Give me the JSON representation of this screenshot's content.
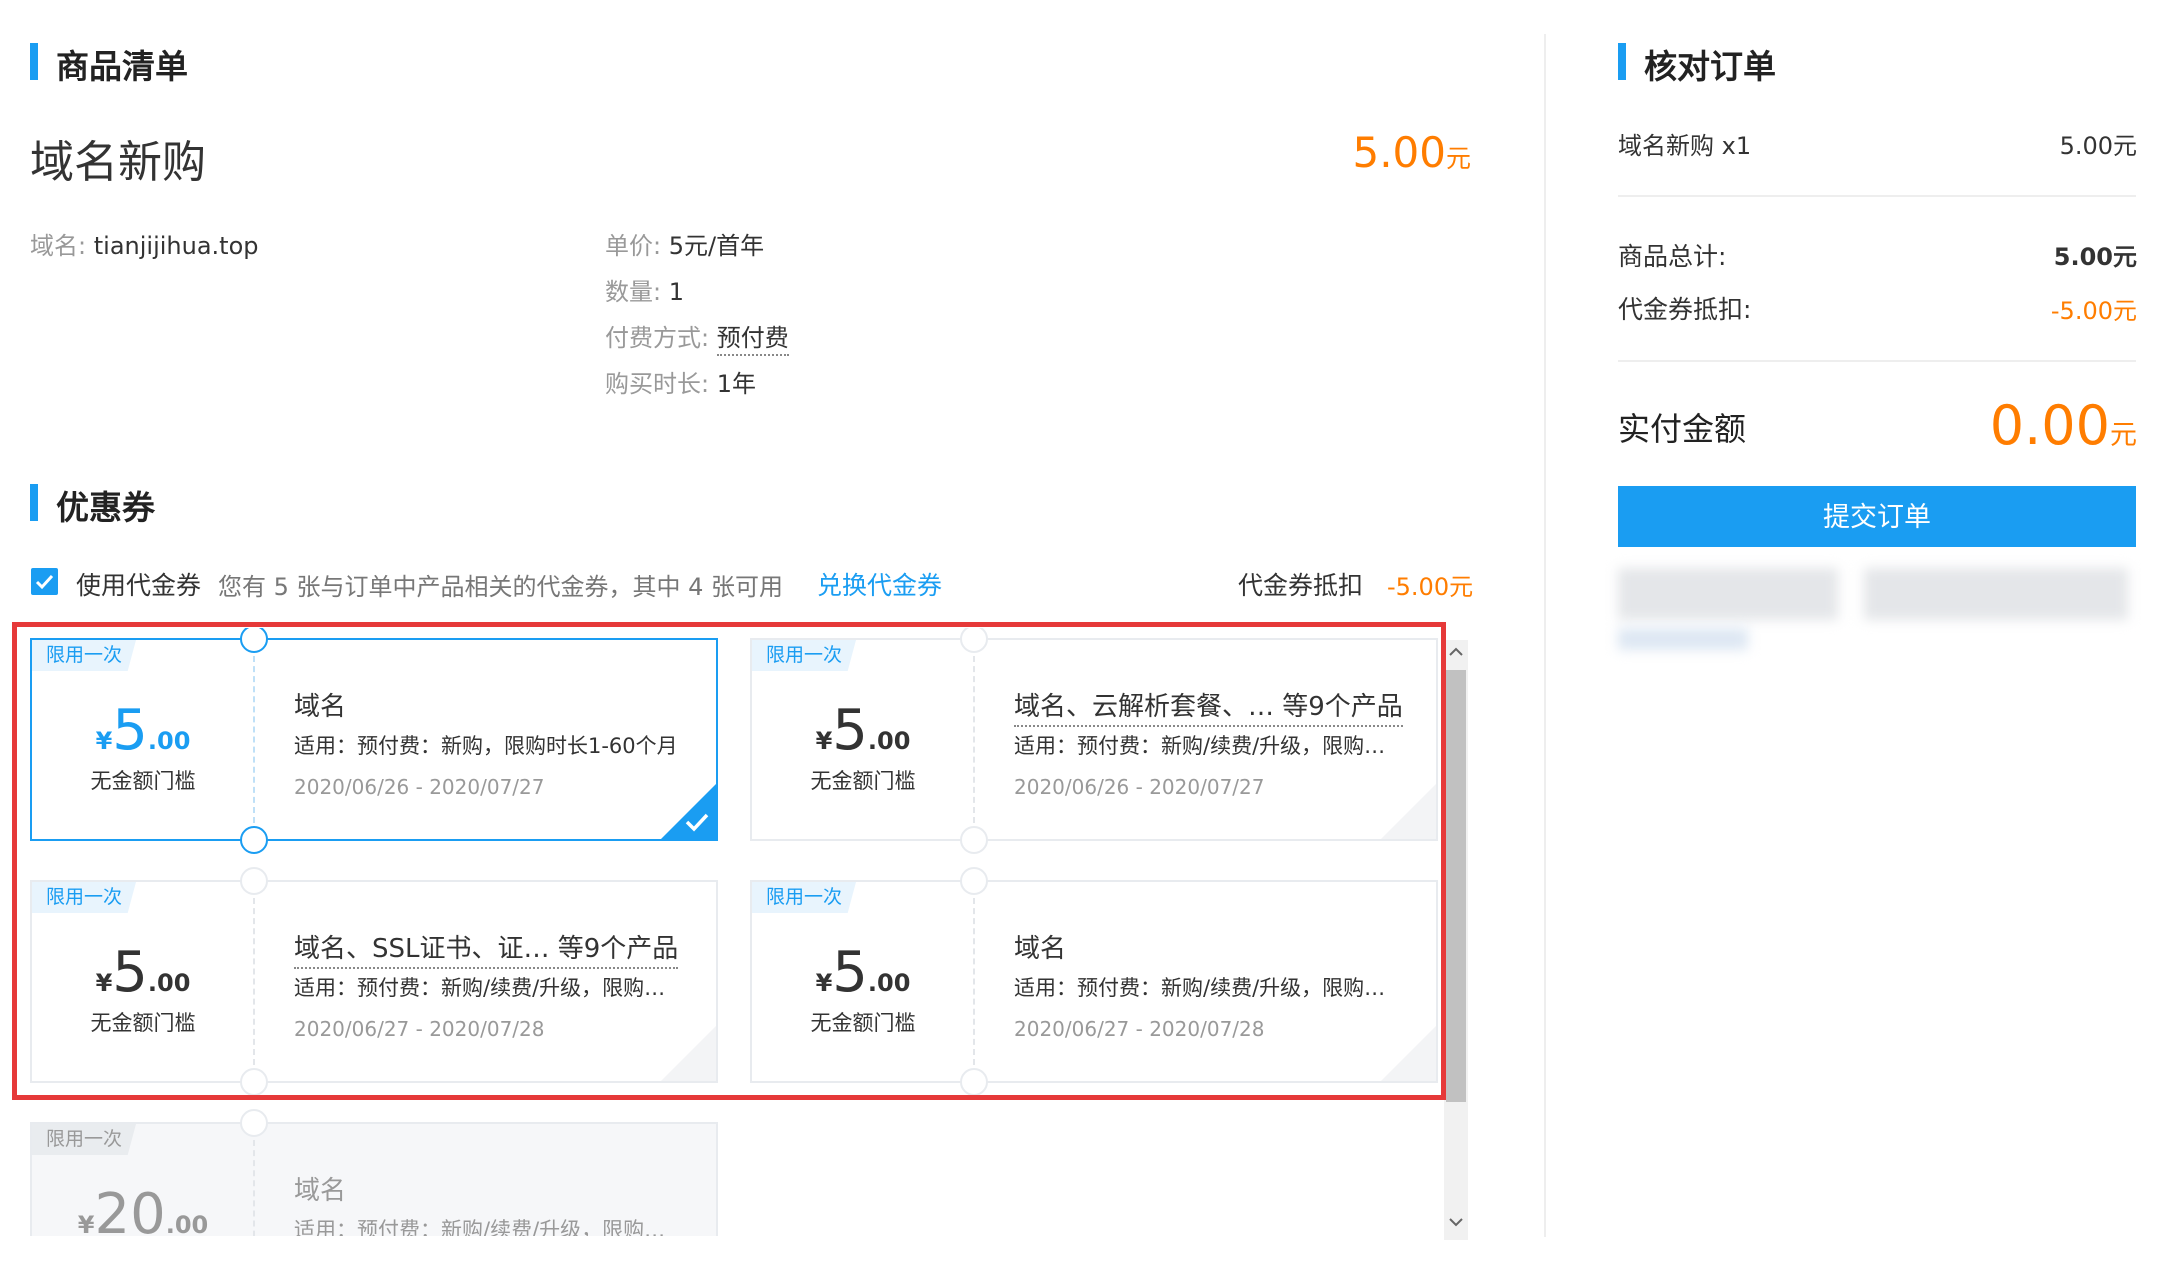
{
  "colors": {
    "accent": "#1a9df2",
    "price": "#ff7d00",
    "highlight_border": "#e63939"
  },
  "product_list": {
    "section_title": "商品清单",
    "product_name": "域名新购",
    "price_number": "5.00",
    "price_unit": "元",
    "domain_label": "域名:",
    "domain_value": "tianjijihua.top",
    "unit_price_label": "单价:",
    "unit_price_value": "5元/首年",
    "quantity_label": "数量:",
    "quantity_value": "1",
    "pay_method_label": "付费方式:",
    "pay_method_value": "预付费",
    "duration_label": "购买时长:",
    "duration_value": "1年"
  },
  "coupons": {
    "section_title": "优惠券",
    "use_label": "使用代金券",
    "info_text": "您有 5 张与订单中产品相关的代金券，其中 4 张可用",
    "exchange_link": "兑换代金券",
    "deduct_label": "代金券抵扣",
    "deduct_value": "-5.00元",
    "cards": [
      {
        "tag": "限用一次",
        "currency": "¥",
        "amount_int": "5",
        "amount_dec": ".00",
        "threshold": "无金额门槛",
        "name": "域名",
        "apply": "适用：预付费：新购，限购时长1-60个月",
        "date": "2020/06/26 - 2020/07/27"
      },
      {
        "tag": "限用一次",
        "currency": "¥",
        "amount_int": "5",
        "amount_dec": ".00",
        "threshold": "无金额门槛",
        "name": "域名、云解析套餐、… 等9个产品",
        "apply": "适用：预付费：新购/续费/升级，限购…",
        "date": "2020/06/26 - 2020/07/27"
      },
      {
        "tag": "限用一次",
        "currency": "¥",
        "amount_int": "5",
        "amount_dec": ".00",
        "threshold": "无金额门槛",
        "name": "域名、SSL证书、证… 等9个产品",
        "apply": "适用：预付费：新购/续费/升级，限购…",
        "date": "2020/06/27 - 2020/07/28"
      },
      {
        "tag": "限用一次",
        "currency": "¥",
        "amount_int": "5",
        "amount_dec": ".00",
        "threshold": "无金额门槛",
        "name": "域名",
        "apply": "适用：预付费：新购/续费/升级，限购…",
        "date": "2020/06/27 - 2020/07/28"
      },
      {
        "tag": "限用一次",
        "currency": "¥",
        "amount_int": "20",
        "amount_dec": ".00",
        "name": "域名",
        "apply": "适用：预付费：新购/续费/升级，限购…"
      }
    ]
  },
  "order_check": {
    "section_title": "核对订单",
    "item_label": "域名新购 x1",
    "item_value": "5.00元",
    "subtotal_label": "商品总计:",
    "subtotal_value": "5.00元",
    "coupon_deduct_label": "代金券抵扣:",
    "coupon_deduct_value": "-5.00元",
    "total_label": "实付金额",
    "total_number": "0.00",
    "total_unit": "元",
    "submit_label": "提交订单"
  }
}
